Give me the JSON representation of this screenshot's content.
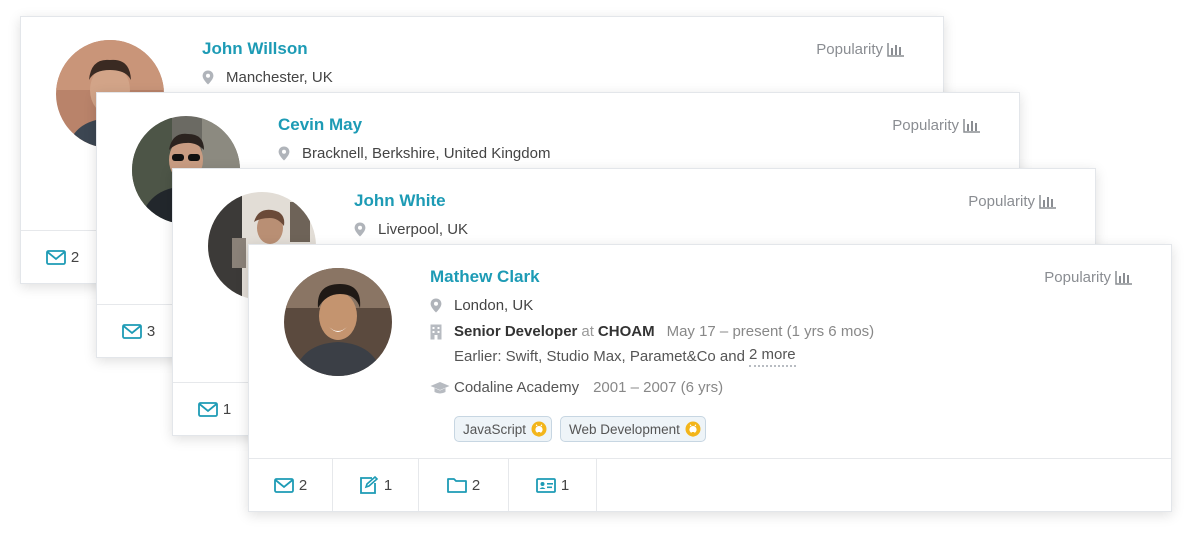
{
  "popularity_label": "Popularity",
  "colors": {
    "accent": "#1d9bb5",
    "muted": "#8a8d92",
    "tag_bg": "#eef4f8",
    "badge_yellow": "#f3b51a"
  },
  "cards": [
    {
      "name": "John Willson",
      "location": "Manchester, UK",
      "footer": {
        "messages": "2"
      }
    },
    {
      "name": "Cevin May",
      "location": "Bracknell, Berkshire, United Kingdom",
      "footer": {
        "messages": "3"
      }
    },
    {
      "name": "John White",
      "location": "Liverpool, UK",
      "footer": {
        "messages": "1"
      }
    },
    {
      "name": "Mathew Clark",
      "location": "London, UK",
      "experience": {
        "title": "Senior Developer",
        "at": "at",
        "company": "CHOAM",
        "dates": "May 17 – present (1 yrs 6 mos)",
        "earlier": "Earlier: Swift, Studio Max, Paramet&Co and",
        "more": "2 more"
      },
      "education": {
        "school": "Codaline Academy",
        "dates": "2001 – 2007 (6 yrs)"
      },
      "tags": [
        "JavaScript",
        "Web Development"
      ],
      "footer": {
        "messages": "2",
        "notes": "1",
        "folders": "2",
        "contacts": "1"
      }
    }
  ]
}
